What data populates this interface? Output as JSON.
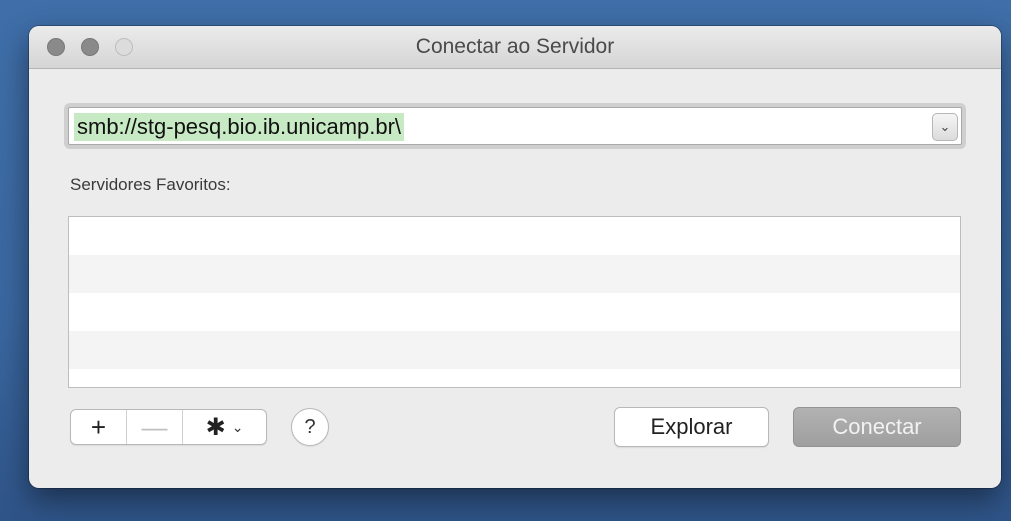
{
  "window": {
    "title": "Conectar ao Servidor"
  },
  "address": {
    "value": "smb://stg-pesq.bio.ib.unicamp.br\\",
    "dropdown_icon": "chevron-down-icon"
  },
  "favorites": {
    "label": "Servidores Favoritos:",
    "items": []
  },
  "toolbar": {
    "add_glyph": "+",
    "remove_glyph": "—",
    "gear_glyph": "✱",
    "gear_chevron": "⌄",
    "help_glyph": "?"
  },
  "buttons": {
    "browse_label": "Explorar",
    "connect_label": "Conectar"
  }
}
